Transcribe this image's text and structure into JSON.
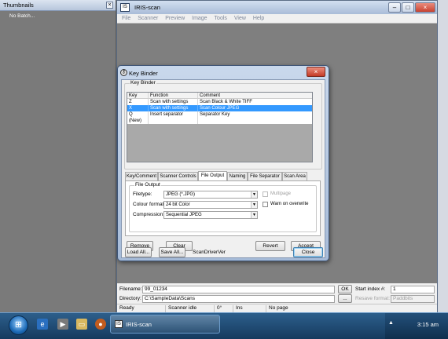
{
  "thumbnails": {
    "title": "Thumbnails",
    "close_glyph": "×",
    "empty_text": "No Batch..."
  },
  "app": {
    "title": "IRIS-scan",
    "icon_text": "IS",
    "menu": [
      "File",
      "Scanner",
      "Preview",
      "Image",
      "Tools",
      "View",
      "Help"
    ]
  },
  "dialog": {
    "title": "Key Binder",
    "group_label": "Key Binder",
    "table": {
      "headers": [
        "Key",
        "Function",
        "Comment"
      ],
      "rows": [
        {
          "key": "Z",
          "function": "Scan with settings",
          "comment": "Scan Black & White TIFF",
          "selected": false
        },
        {
          "key": "X",
          "function": "Scan with settings",
          "comment": "Scan Colour JPEG",
          "selected": true
        },
        {
          "key": "Q",
          "function": "Insert separator",
          "comment": "Separator Key",
          "selected": false
        },
        {
          "key": "(New)",
          "function": "",
          "comment": "",
          "selected": false
        }
      ]
    },
    "tabs": [
      "Key/Comment",
      "Scanner Controls",
      "File Output",
      "Naming",
      "File Separator",
      "Scan Area"
    ],
    "active_tab": "File Output",
    "file_output": {
      "group_label": "File Output",
      "filetype_label": "Filetype:",
      "filetype_value": "JPEG (*.JPG)",
      "colour_label": "Colour format:",
      "colour_value": "24 bit Color",
      "compression_label": "Compression:",
      "compression_value": "Sequential JPEG",
      "multipage_label": "Multipage",
      "multipage_checked": false,
      "warn_label": "Warn on overwrite",
      "warn_checked": false
    },
    "buttons": {
      "remove": "Remove",
      "clear": "Clear",
      "revert": "Revert",
      "accept": "Accept",
      "load": "Load All...",
      "save": "Save All...",
      "close": "Close"
    },
    "driver_text": "ScanDriverVer"
  },
  "fields": {
    "filename_label": "Filename:",
    "filename_value": "99_01234",
    "directory_label": "Directory:",
    "directory_value": "C:\\SampleData\\Scans",
    "ok_label": "OK",
    "browse_label": "...",
    "start_index_label": "Start index #:",
    "start_index_value": "1",
    "resave_label": "Resave format:",
    "resave_value": "Paddbits"
  },
  "status": {
    "state": "Ready",
    "scanner": "Scanner idle",
    "rotation": "0°",
    "mode": "Ins",
    "page": "No page"
  },
  "taskbar": {
    "app_label": "IRIS-scan",
    "clock": "3:15 am"
  }
}
